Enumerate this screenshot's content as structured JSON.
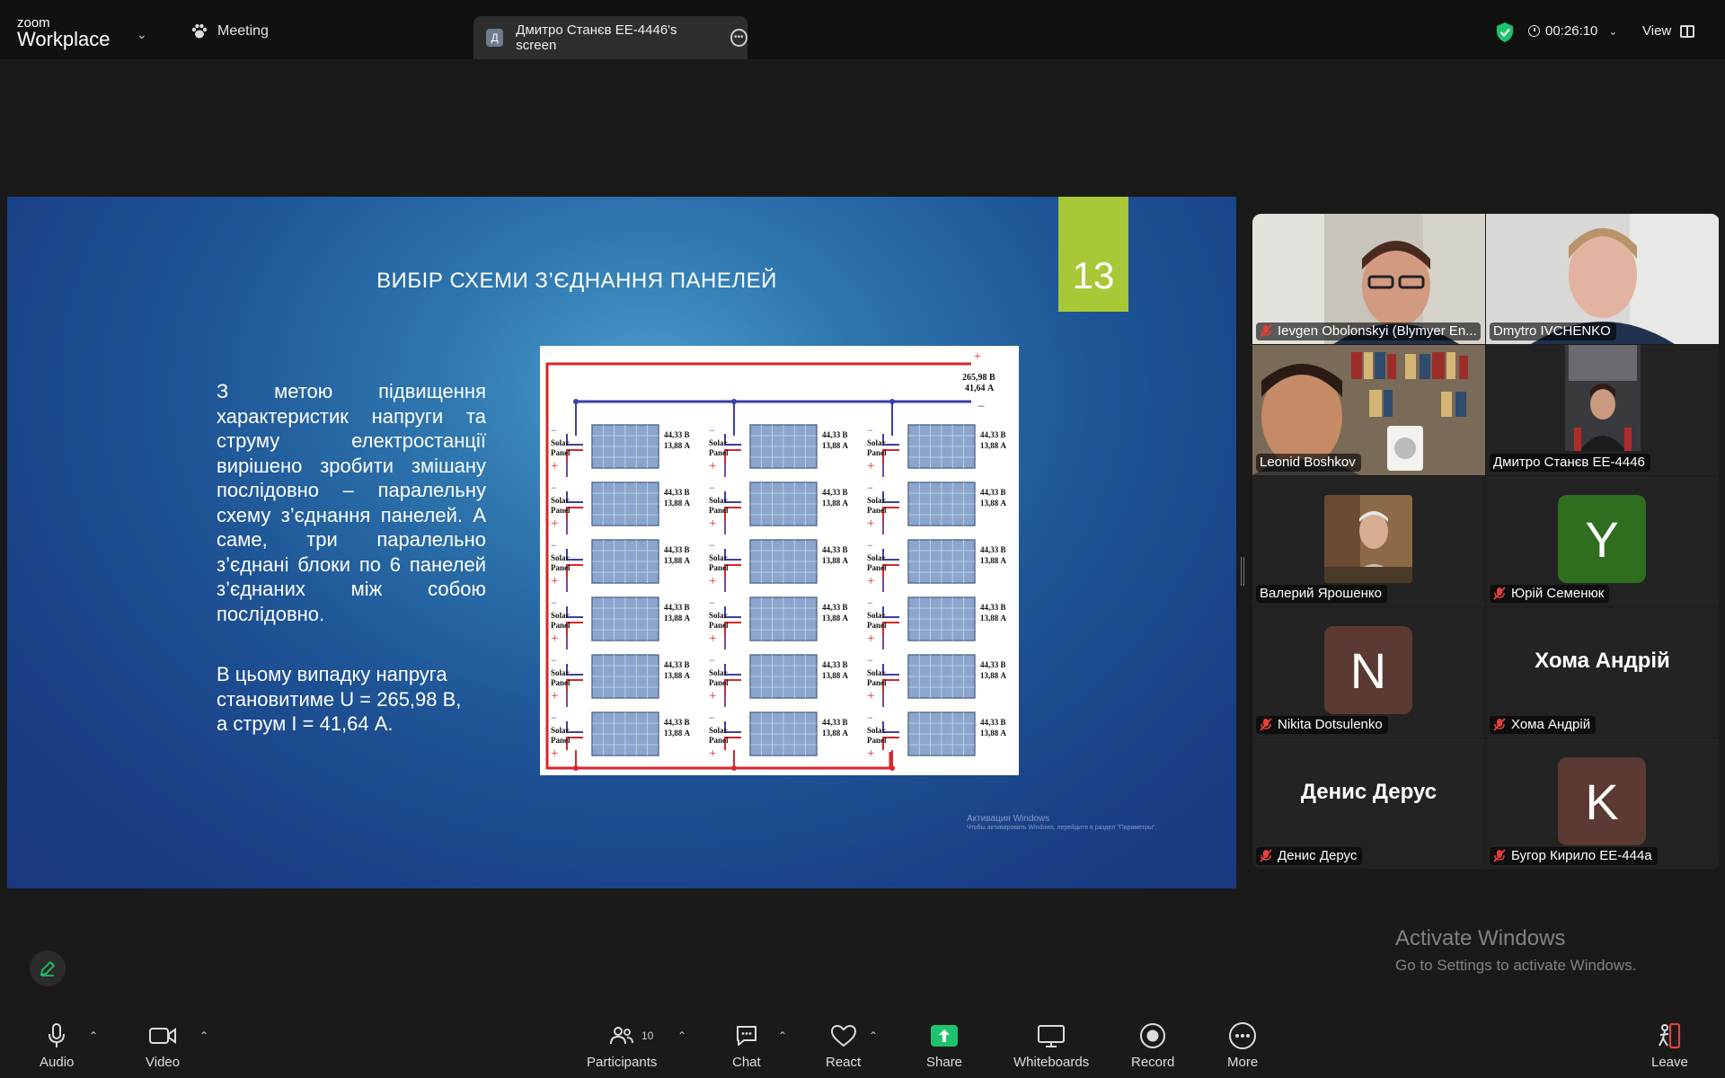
{
  "app": {
    "brand_small": "zoom",
    "brand_big": "Workplace"
  },
  "topbar": {
    "meeting_label": "Meeting",
    "screen_tab_initial": "Д",
    "screen_tab_label": "Дмитро Станєв ЕЕ-4446's screen",
    "timer": "00:26:10",
    "view_label": "View"
  },
  "slide": {
    "title": "ВИБІР СХЕМИ З’ЄДНАННЯ ПАНЕЛЕЙ",
    "number": "13",
    "paragraph1": "З метою підвищення характеристик напруги та струму електростанції вирішено зробити змішану послідовно – паралельну схему з’єднання панелей. А саме, три паралельно з’єднані блоки по 6 панелей з’єднаних між собою послідовно.",
    "paragraph2_line1": "В цьому випадку напруга",
    "paragraph2_line2": "становитиме U = 265,98 В,",
    "paragraph2_line3": "а струм I = 41,64 А.",
    "activate_title": "Активация Windows",
    "activate_sub": "Чтобы активировать Windows, перейдите в раздел \"Параметры\".",
    "diagram": {
      "total_voltage": "265,98 В",
      "total_current": "41,64 А",
      "panel_label_1": "Solar",
      "panel_label_2": "Panel",
      "panel_voltage": "44,33 В",
      "panel_current": "13,88 А",
      "plus": "+",
      "minus": "−"
    }
  },
  "participants": [
    {
      "name": "Ievgen Obolonskyi (Blymyer En...",
      "muted": true,
      "type": "video"
    },
    {
      "name": "Dmytro IVCHENKO",
      "muted": false,
      "type": "video"
    },
    {
      "name": "Leonid Boshkov",
      "muted": false,
      "type": "video"
    },
    {
      "name": "Дмитро Станєв ЕЕ-4446",
      "muted": false,
      "type": "video",
      "active_speaker": true
    },
    {
      "name": "Валерий Ярошенко",
      "muted": false,
      "type": "photo"
    },
    {
      "name": "Юрій Семенюк",
      "muted": true,
      "type": "avatar",
      "initial": "Y",
      "color": "#2f6e1f"
    },
    {
      "name": "Nikita Dotsulenko",
      "muted": true,
      "type": "avatar",
      "initial": "N",
      "color": "#5a3a32"
    },
    {
      "name": "Хома Андрій",
      "muted": true,
      "type": "name",
      "display": "Хома Андрій"
    },
    {
      "name": "Денис Дерус",
      "muted": true,
      "type": "name",
      "display": "Денис Дерус"
    },
    {
      "name": "Бугор Кирило ЕЕ-444а",
      "muted": true,
      "type": "avatar",
      "initial": "K",
      "color": "#5a3a32"
    }
  ],
  "activate_windows": {
    "title": "Activate Windows",
    "subtitle": "Go to Settings to activate Windows."
  },
  "toolbar": {
    "audio": "Audio",
    "video": "Video",
    "participants": "Participants",
    "participants_count": "10",
    "chat": "Chat",
    "react": "React",
    "share": "Share",
    "whiteboards": "Whiteboards",
    "record": "Record",
    "more": "More",
    "leave": "Leave"
  },
  "colors": {
    "accent_green": "#1ee29a",
    "share_green": "#1ec46b",
    "slide_num_bg": "#a8c838",
    "muted_red": "#e0413c"
  }
}
